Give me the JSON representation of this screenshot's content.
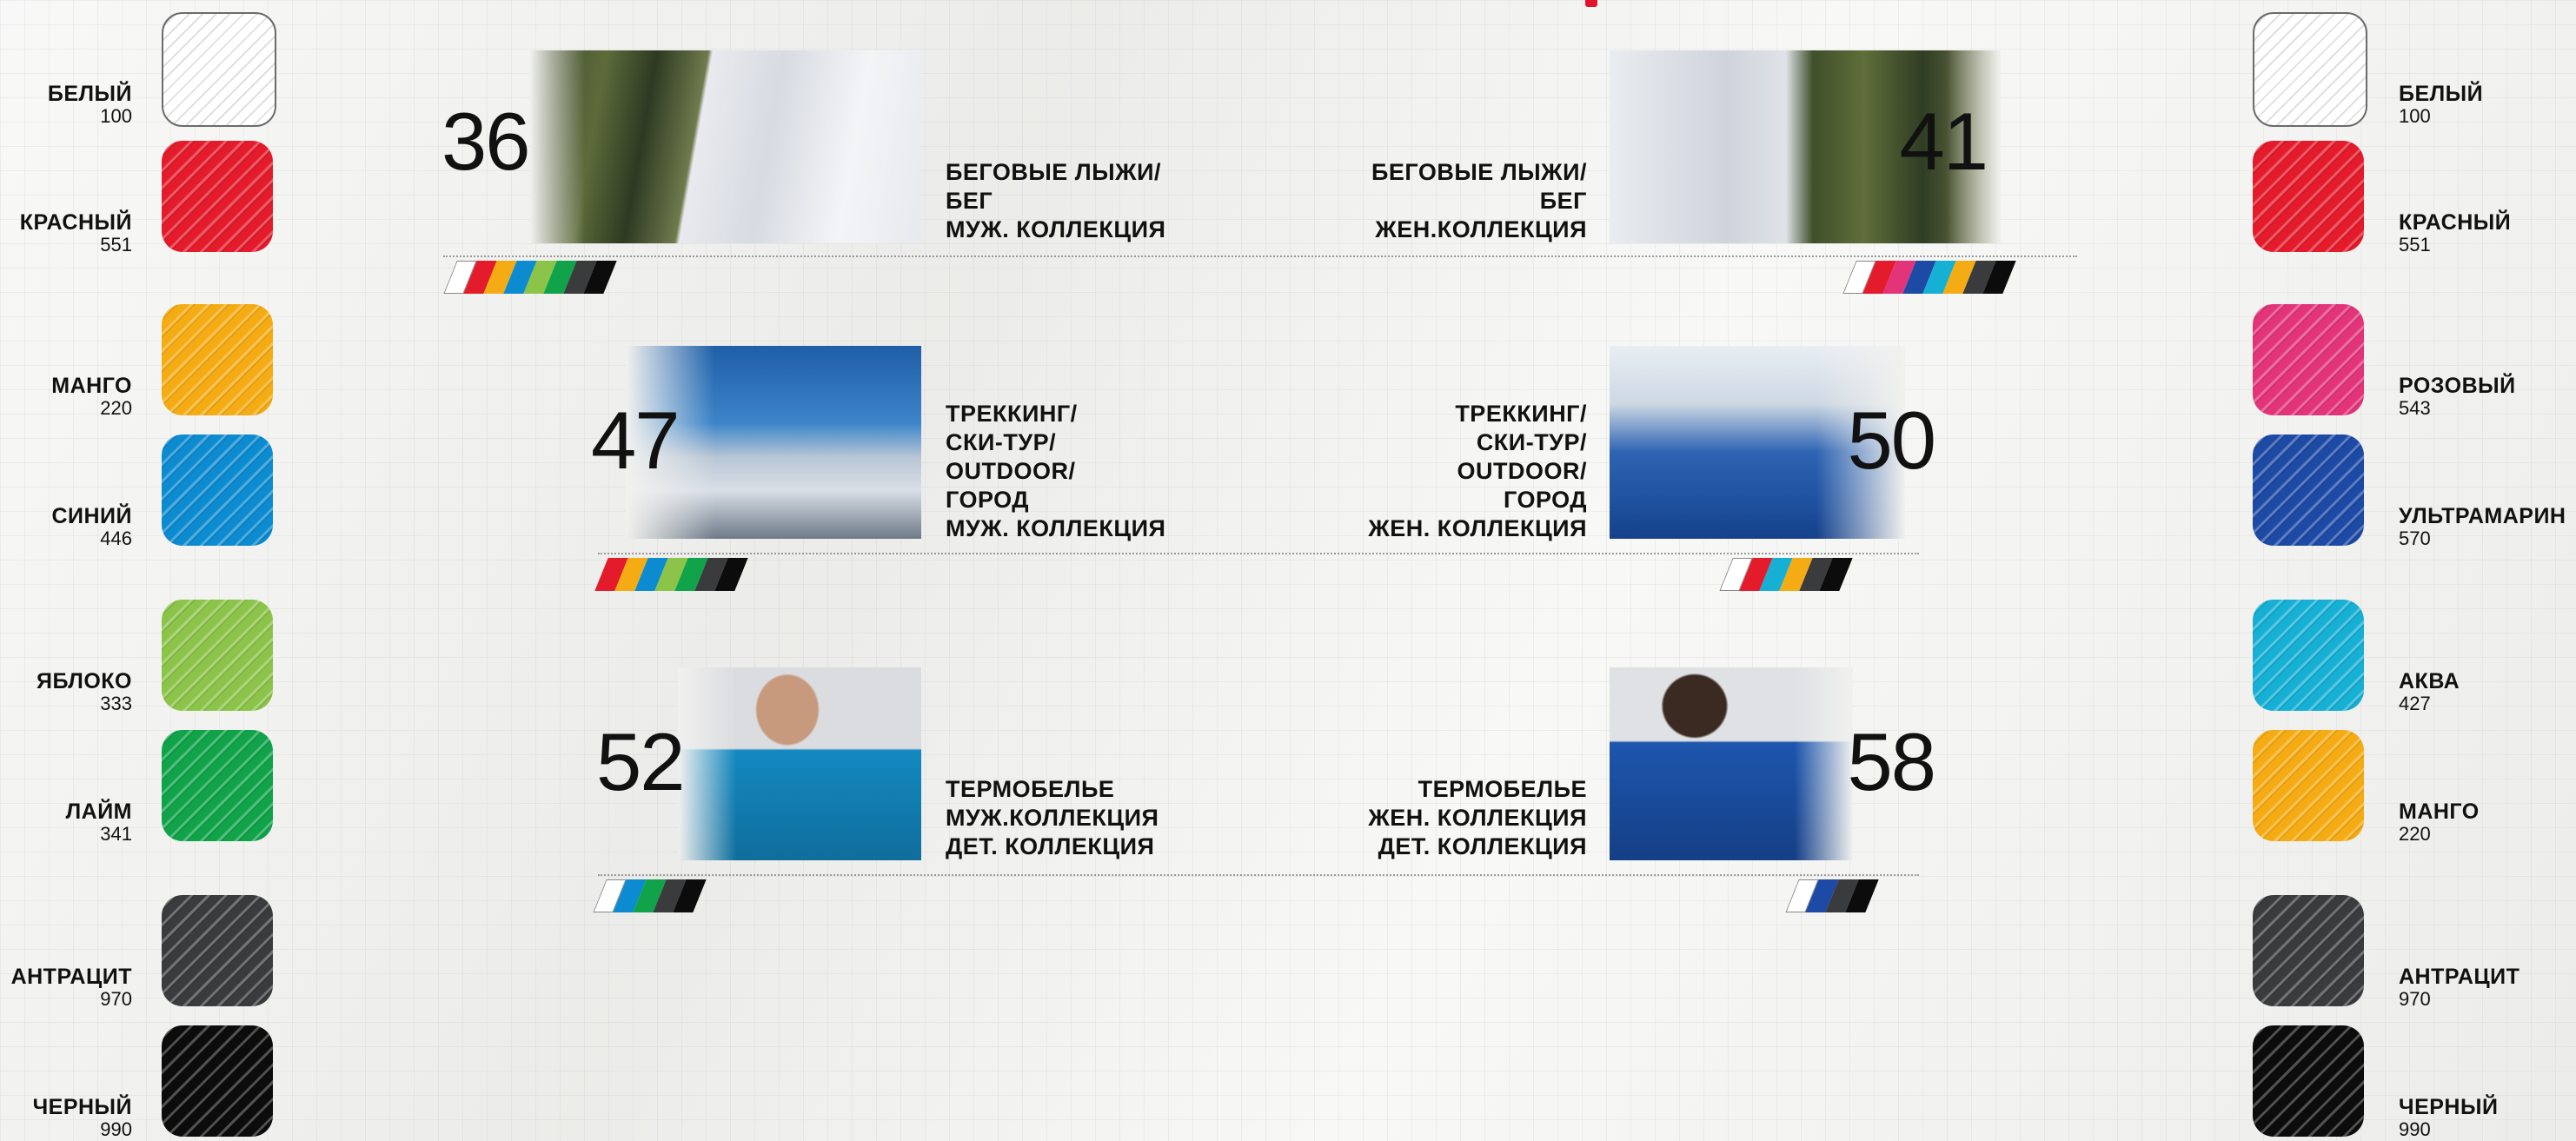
{
  "top_strip_text": "· · · · · · · · · · · · · · · · · · · · ·",
  "left_swatches": [
    {
      "name": "БЕЛЫЙ",
      "code": "100",
      "color": "#ffffff"
    },
    {
      "name": "КРАСНЫЙ",
      "code": "551",
      "color": "#e41b2b"
    },
    {
      "name": "МАНГО",
      "code": "220",
      "color": "#f5ac14"
    },
    {
      "name": "СИНИЙ",
      "code": "446",
      "color": "#0c8bd0"
    },
    {
      "name": "ЯБЛОКО",
      "code": "333",
      "color": "#8cc44a"
    },
    {
      "name": "ЛАЙМ",
      "code": "341",
      "color": "#10a34a"
    },
    {
      "name": "АНТРАЦИТ",
      "code": "970",
      "color": "#3a3b3d"
    },
    {
      "name": "ЧЕРНЫЙ",
      "code": "990",
      "color": "#0c0c0c"
    }
  ],
  "right_swatches": [
    {
      "name": "БЕЛЫЙ",
      "code": "100",
      "color": "#ffffff"
    },
    {
      "name": "КРАСНЫЙ",
      "code": "551",
      "color": "#e41b2b"
    },
    {
      "name": "РОЗОВЫЙ",
      "code": "543",
      "color": "#e3347a"
    },
    {
      "name": "УЛЬТРАМАРИН",
      "code": "570",
      "color": "#1d4aa5"
    },
    {
      "name": "АКВА",
      "code": "427",
      "color": "#16b0d4"
    },
    {
      "name": "МАНГО",
      "code": "220",
      "color": "#f5ac14"
    },
    {
      "name": "АНТРАЦИТ",
      "code": "970",
      "color": "#3a3b3d"
    },
    {
      "name": "ЧЕРНЫЙ",
      "code": "990",
      "color": "#0c0c0c"
    }
  ],
  "categories": [
    {
      "id": "ski-men",
      "page": "36",
      "lines": [
        "БЕГОВЫЕ ЛЫЖИ/",
        "БЕГ",
        "МУЖ. КОЛЛЕКЦИЯ"
      ],
      "photo": "skiers-forest",
      "colors": [
        "#ffffff",
        "#e41b2b",
        "#f5ac14",
        "#0c8bd0",
        "#8cc44a",
        "#10a34a",
        "#3a3b3d",
        "#0c0c0c"
      ]
    },
    {
      "id": "ski-women",
      "page": "41",
      "lines": [
        "БЕГОВЫЕ ЛЫЖИ/",
        "БЕГ",
        "ЖЕН.КОЛЛЕКЦИЯ"
      ],
      "photo": "skier-forest-runner",
      "colors": [
        "#ffffff",
        "#e41b2b",
        "#e3347a",
        "#1d4aa5",
        "#16b0d4",
        "#f5ac14",
        "#3a3b3d",
        "#0c0c0c"
      ]
    },
    {
      "id": "trek-men",
      "page": "47",
      "lines": [
        "ТРЕККИНГ/",
        "СКИ-ТУР/",
        "OUTDOOR/",
        "ГОРОД",
        "МУЖ. КОЛЛЕКЦИЯ"
      ],
      "photo": "mountain-ridge",
      "colors": [
        "#e41b2b",
        "#f5ac14",
        "#0c8bd0",
        "#8cc44a",
        "#10a34a",
        "#3a3b3d",
        "#0c0c0c"
      ]
    },
    {
      "id": "trek-women",
      "page": "50",
      "lines": [
        "ТРЕККИНГ/",
        "СКИ-ТУР/",
        "OUTDOOR/",
        "ГОРОД",
        "ЖЕН. КОЛЛЕКЦИЯ"
      ],
      "photo": "summit-cross",
      "colors": [
        "#ffffff",
        "#e41b2b",
        "#16b0d4",
        "#f5ac14",
        "#3a3b3d",
        "#0c0c0c"
      ]
    },
    {
      "id": "thermo-men",
      "page": "52",
      "lines": [
        "ТЕРМОБЕЛЬЕ",
        "МУЖ.КОЛЛЕКЦИЯ",
        "ДЕТ. КОЛЛЕКЦИЯ"
      ],
      "photo": "man-blue-shirt",
      "colors": [
        "#ffffff",
        "#0c8bd0",
        "#10a34a",
        "#3a3b3d",
        "#0c0c0c"
      ]
    },
    {
      "id": "thermo-women",
      "page": "58",
      "lines": [
        "ТЕРМОБЕЛЬЕ",
        "ЖЕН. КОЛЛЕКЦИЯ",
        "ДЕТ. КОЛЛЕКЦИЯ"
      ],
      "photo": "woman-blue-shirt",
      "colors": [
        "#ffffff",
        "#1d4aa5",
        "#3a3b3d",
        "#0c0c0c"
      ]
    }
  ]
}
